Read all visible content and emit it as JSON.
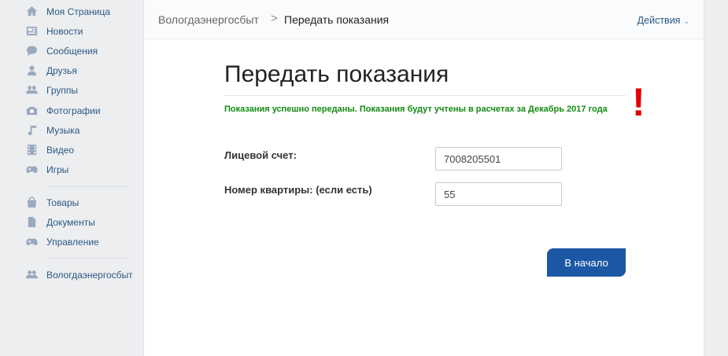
{
  "sidebar": {
    "items": [
      {
        "label": "Моя Страница",
        "icon": "home-icon"
      },
      {
        "label": "Новости",
        "icon": "news-icon"
      },
      {
        "label": "Сообщения",
        "icon": "messages-icon"
      },
      {
        "label": "Друзья",
        "icon": "friends-icon"
      },
      {
        "label": "Группы",
        "icon": "groups-icon"
      },
      {
        "label": "Фотографии",
        "icon": "camera-icon"
      },
      {
        "label": "Музыка",
        "icon": "music-note-icon"
      },
      {
        "label": "Видео",
        "icon": "video-film-icon"
      },
      {
        "label": "Игры",
        "icon": "gamepad-icon"
      },
      {
        "label": "Товары",
        "icon": "shopping-bag-icon"
      },
      {
        "label": "Документы",
        "icon": "document-icon"
      },
      {
        "label": "Управление",
        "icon": "gamepad-icon"
      },
      {
        "label": "Вологдаэнергосбыт",
        "icon": "groups-icon"
      }
    ]
  },
  "header": {
    "breadcrumb_app": "Вологдаэнергосбыт",
    "breadcrumb_separator": ">",
    "breadcrumb_page": "Передать показания",
    "actions_label": "Действия",
    "actions_chevron": "⌄"
  },
  "main": {
    "title": "Передать показания",
    "success_message": "Показания успешно переданы. Показания будут учтены в расчетах за Декабрь 2017 года",
    "exclamation": "!",
    "account_label": "Лицевой счет:",
    "account_value": "7008205501",
    "apartment_label": "Номер квартиры: (если есть)",
    "apartment_value": "55",
    "home_button": "В начало"
  },
  "colors": {
    "accent": "#2a5885",
    "button": "#1c57a5",
    "success": "#128a12",
    "alert": "#e10000"
  }
}
